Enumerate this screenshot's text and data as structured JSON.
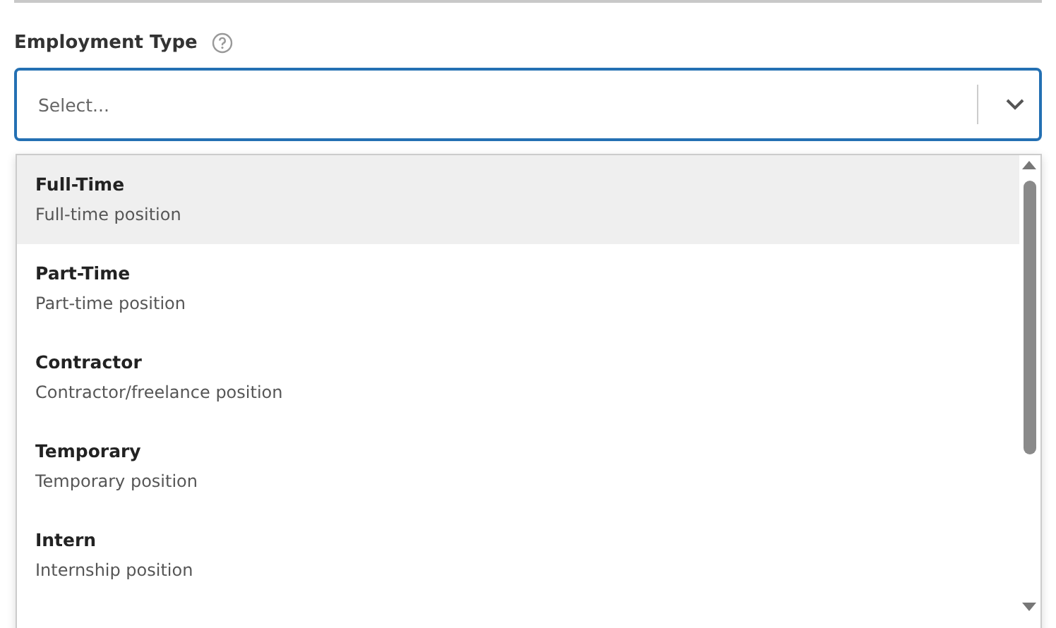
{
  "field": {
    "label": "Employment Type",
    "placeholder": "Select..."
  },
  "options": [
    {
      "title": "Full-Time",
      "description": "Full-time position",
      "highlighted": true
    },
    {
      "title": "Part-Time",
      "description": "Part-time position",
      "highlighted": false
    },
    {
      "title": "Contractor",
      "description": "Contractor/freelance position",
      "highlighted": false
    },
    {
      "title": "Temporary",
      "description": "Temporary position",
      "highlighted": false
    },
    {
      "title": "Intern",
      "description": "Internship position",
      "highlighted": false
    }
  ]
}
